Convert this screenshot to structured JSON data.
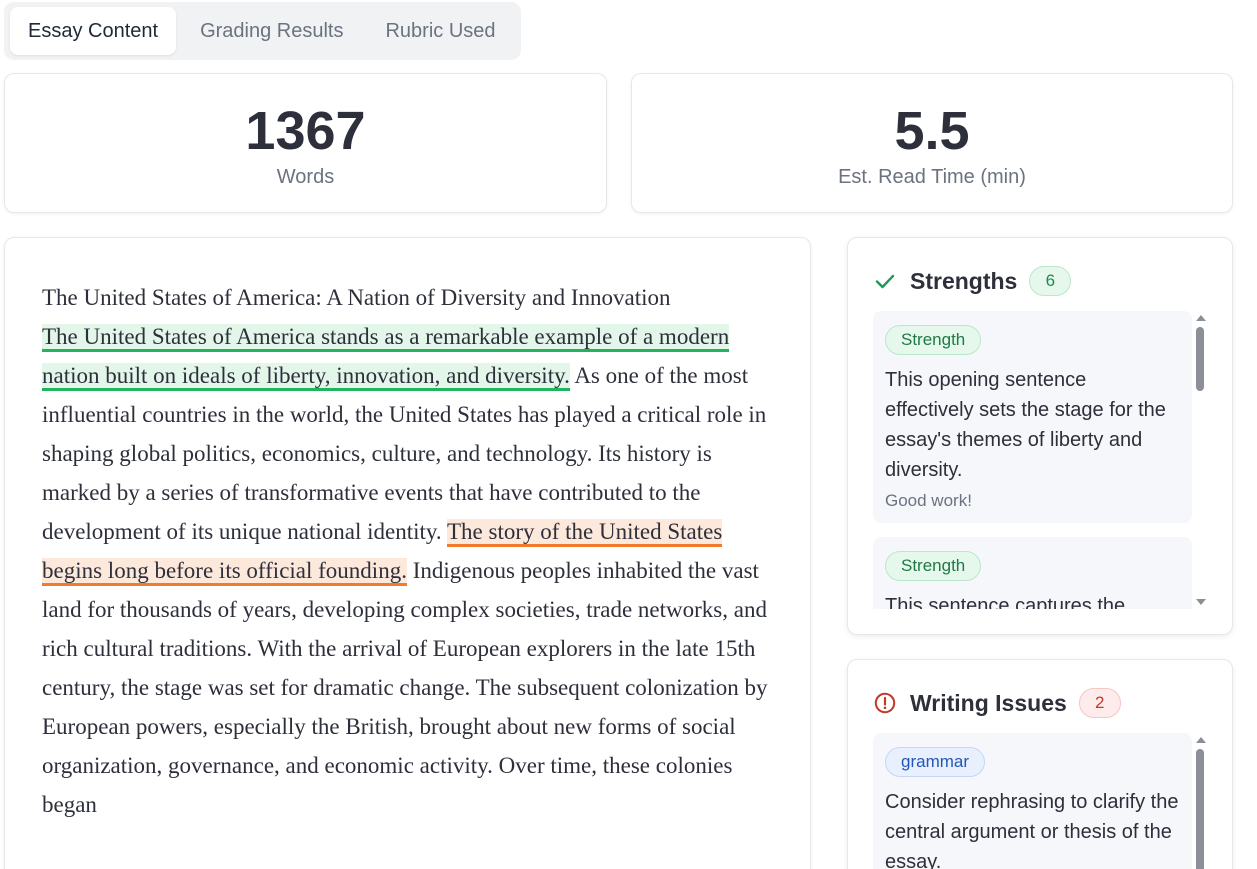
{
  "tabs": [
    {
      "label": "Essay Content"
    },
    {
      "label": "Grading Results"
    },
    {
      "label": "Rubric Used"
    }
  ],
  "stats": {
    "words": {
      "value": "1367",
      "label": "Words"
    },
    "read_time": {
      "value": "5.5",
      "label": "Est. Read Time (min)"
    }
  },
  "essay": {
    "p1": "The United States of America: A Nation of Diversity and Innovation",
    "hl1": "The United States of America stands as a remarkable example of a modern nation built on ideals of liberty, innovation, and diversity.",
    "p2": " As one of the most influential countries in the world, the United States has played a critical role in shaping global politics, economics, culture, and technology. Its history is marked by a series of transformative events that have contributed to the development of its unique national identity. ",
    "hl2": "The story of the United States begins long before its official founding.",
    "p3": " Indigenous peoples inhabited the vast land for thousands of years, developing complex societies, trade networks, and rich cultural traditions. With the arrival of European explorers in the late 15th century, the stage was set for dramatic change. The subsequent colonization by European powers, especially the British, brought about new forms of social organization, governance, and economic activity. Over time, these colonies began"
  },
  "strengths": {
    "title": "Strengths",
    "count": "6",
    "items": [
      {
        "tag": "Strength",
        "text": "This opening sentence effectively sets the stage for the essay's themes of liberty and diversity.",
        "sub": "Good work!"
      },
      {
        "tag": "Strength",
        "text": "This sentence captures the"
      }
    ]
  },
  "issues": {
    "title": "Writing Issues",
    "count": "2",
    "items": [
      {
        "tag": "grammar",
        "text": "Consider rephrasing to clarify the central argument or thesis of the essay."
      }
    ]
  },
  "colors": {
    "highlight_green": "#22b35e",
    "highlight_orange": "#f07b2c",
    "strength": "#1f8a4c",
    "issue": "#c0392b"
  }
}
